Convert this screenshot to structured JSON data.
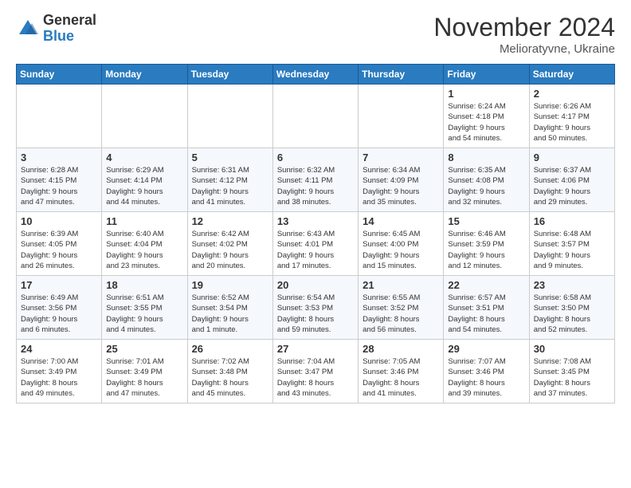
{
  "logo": {
    "general": "General",
    "blue": "Blue"
  },
  "title": "November 2024",
  "location": "Melioratyvne, Ukraine",
  "weekdays": [
    "Sunday",
    "Monday",
    "Tuesday",
    "Wednesday",
    "Thursday",
    "Friday",
    "Saturday"
  ],
  "weeks": [
    [
      {
        "day": "",
        "info": ""
      },
      {
        "day": "",
        "info": ""
      },
      {
        "day": "",
        "info": ""
      },
      {
        "day": "",
        "info": ""
      },
      {
        "day": "",
        "info": ""
      },
      {
        "day": "1",
        "info": "Sunrise: 6:24 AM\nSunset: 4:18 PM\nDaylight: 9 hours\nand 54 minutes."
      },
      {
        "day": "2",
        "info": "Sunrise: 6:26 AM\nSunset: 4:17 PM\nDaylight: 9 hours\nand 50 minutes."
      }
    ],
    [
      {
        "day": "3",
        "info": "Sunrise: 6:28 AM\nSunset: 4:15 PM\nDaylight: 9 hours\nand 47 minutes."
      },
      {
        "day": "4",
        "info": "Sunrise: 6:29 AM\nSunset: 4:14 PM\nDaylight: 9 hours\nand 44 minutes."
      },
      {
        "day": "5",
        "info": "Sunrise: 6:31 AM\nSunset: 4:12 PM\nDaylight: 9 hours\nand 41 minutes."
      },
      {
        "day": "6",
        "info": "Sunrise: 6:32 AM\nSunset: 4:11 PM\nDaylight: 9 hours\nand 38 minutes."
      },
      {
        "day": "7",
        "info": "Sunrise: 6:34 AM\nSunset: 4:09 PM\nDaylight: 9 hours\nand 35 minutes."
      },
      {
        "day": "8",
        "info": "Sunrise: 6:35 AM\nSunset: 4:08 PM\nDaylight: 9 hours\nand 32 minutes."
      },
      {
        "day": "9",
        "info": "Sunrise: 6:37 AM\nSunset: 4:06 PM\nDaylight: 9 hours\nand 29 minutes."
      }
    ],
    [
      {
        "day": "10",
        "info": "Sunrise: 6:39 AM\nSunset: 4:05 PM\nDaylight: 9 hours\nand 26 minutes."
      },
      {
        "day": "11",
        "info": "Sunrise: 6:40 AM\nSunset: 4:04 PM\nDaylight: 9 hours\nand 23 minutes."
      },
      {
        "day": "12",
        "info": "Sunrise: 6:42 AM\nSunset: 4:02 PM\nDaylight: 9 hours\nand 20 minutes."
      },
      {
        "day": "13",
        "info": "Sunrise: 6:43 AM\nSunset: 4:01 PM\nDaylight: 9 hours\nand 17 minutes."
      },
      {
        "day": "14",
        "info": "Sunrise: 6:45 AM\nSunset: 4:00 PM\nDaylight: 9 hours\nand 15 minutes."
      },
      {
        "day": "15",
        "info": "Sunrise: 6:46 AM\nSunset: 3:59 PM\nDaylight: 9 hours\nand 12 minutes."
      },
      {
        "day": "16",
        "info": "Sunrise: 6:48 AM\nSunset: 3:57 PM\nDaylight: 9 hours\nand 9 minutes."
      }
    ],
    [
      {
        "day": "17",
        "info": "Sunrise: 6:49 AM\nSunset: 3:56 PM\nDaylight: 9 hours\nand 6 minutes."
      },
      {
        "day": "18",
        "info": "Sunrise: 6:51 AM\nSunset: 3:55 PM\nDaylight: 9 hours\nand 4 minutes."
      },
      {
        "day": "19",
        "info": "Sunrise: 6:52 AM\nSunset: 3:54 PM\nDaylight: 9 hours\nand 1 minute."
      },
      {
        "day": "20",
        "info": "Sunrise: 6:54 AM\nSunset: 3:53 PM\nDaylight: 8 hours\nand 59 minutes."
      },
      {
        "day": "21",
        "info": "Sunrise: 6:55 AM\nSunset: 3:52 PM\nDaylight: 8 hours\nand 56 minutes."
      },
      {
        "day": "22",
        "info": "Sunrise: 6:57 AM\nSunset: 3:51 PM\nDaylight: 8 hours\nand 54 minutes."
      },
      {
        "day": "23",
        "info": "Sunrise: 6:58 AM\nSunset: 3:50 PM\nDaylight: 8 hours\nand 52 minutes."
      }
    ],
    [
      {
        "day": "24",
        "info": "Sunrise: 7:00 AM\nSunset: 3:49 PM\nDaylight: 8 hours\nand 49 minutes."
      },
      {
        "day": "25",
        "info": "Sunrise: 7:01 AM\nSunset: 3:49 PM\nDaylight: 8 hours\nand 47 minutes."
      },
      {
        "day": "26",
        "info": "Sunrise: 7:02 AM\nSunset: 3:48 PM\nDaylight: 8 hours\nand 45 minutes."
      },
      {
        "day": "27",
        "info": "Sunrise: 7:04 AM\nSunset: 3:47 PM\nDaylight: 8 hours\nand 43 minutes."
      },
      {
        "day": "28",
        "info": "Sunrise: 7:05 AM\nSunset: 3:46 PM\nDaylight: 8 hours\nand 41 minutes."
      },
      {
        "day": "29",
        "info": "Sunrise: 7:07 AM\nSunset: 3:46 PM\nDaylight: 8 hours\nand 39 minutes."
      },
      {
        "day": "30",
        "info": "Sunrise: 7:08 AM\nSunset: 3:45 PM\nDaylight: 8 hours\nand 37 minutes."
      }
    ]
  ]
}
